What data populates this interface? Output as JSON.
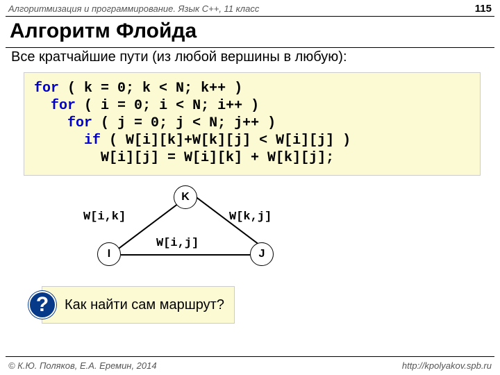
{
  "header": {
    "course": "Алгоритмизация и программирование. Язык C++, 11 класс",
    "page": "115"
  },
  "title": "Алгоритм Флойда",
  "subtitle": "Все кратчайшие пути (из любой вершины в  любую):",
  "code": {
    "l1a": "for",
    "l1b": " ( k = ",
    "l1c": "0",
    "l1d": "; k < N; k++ )",
    "l2a": "for",
    "l2b": " ( i = ",
    "l2c": "0",
    "l2d": "; i < N; i++ )",
    "l3a": "for",
    "l3b": " ( j = ",
    "l3c": "0",
    "l3d": "; j < N; j++ )",
    "l4a": "if",
    "l4b": " ( W[i][k]+W[k][j] < W[i][j] )",
    "l5": "W[i][j] = W[i][k] + W[k][j];"
  },
  "diagram": {
    "K": "K",
    "I": "I",
    "J": "J",
    "wik": "W[i,k]",
    "wkj": "W[k,j]",
    "wij": "W[i,j]"
  },
  "question": {
    "mark": "?",
    "text": "Как найти сам маршрут?"
  },
  "footer": {
    "left": "© К.Ю. Поляков, Е.А. Еремин, 2014",
    "right": "http://kpolyakov.spb.ru"
  }
}
